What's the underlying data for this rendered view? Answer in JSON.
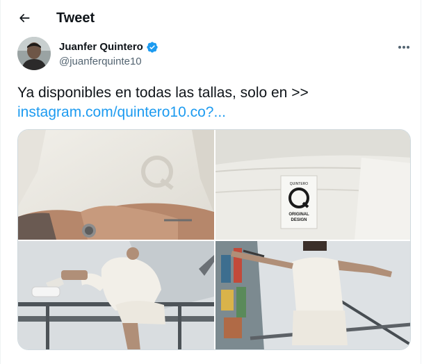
{
  "header": {
    "title": "Tweet",
    "back_icon": "arrow-left-icon"
  },
  "author": {
    "name": "Juanfer Quintero",
    "handle": "@juanferquinte10",
    "verified_icon": "verified-badge-icon",
    "verified_color": "#1d9bf0"
  },
  "more_icon": "more-horizontal-icon",
  "tweet": {
    "text": "Ya disponibles en todas las tallas, solo en >>",
    "link": "instagram.com/quintero10.co?..."
  },
  "media": {
    "label_line1": "ORIGINAL",
    "label_line2": "DESIGN",
    "label_arc": "QUINTERO"
  },
  "colors": {
    "link": "#1d9bf0",
    "secondary_text": "#536471",
    "border": "#cfd9de"
  }
}
